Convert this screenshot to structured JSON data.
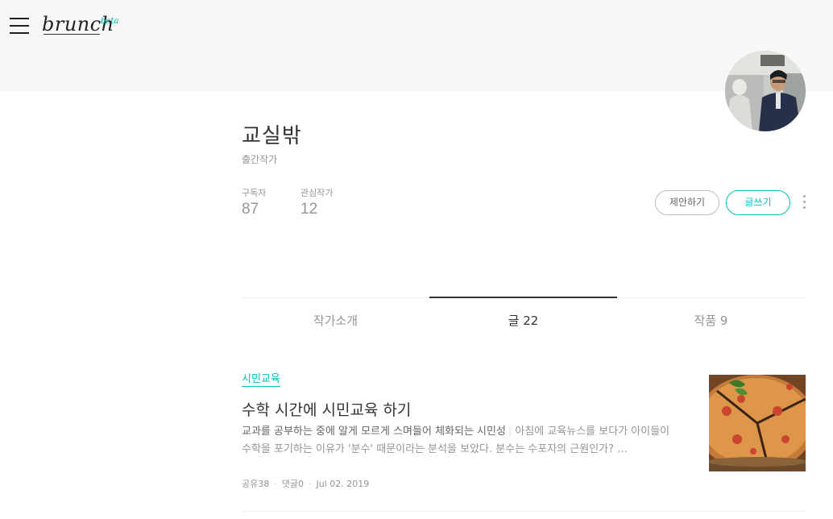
{
  "app": {
    "logo_text": "brunch",
    "logo_badge": "beta"
  },
  "profile": {
    "name": "교실밖",
    "role": "출간작가",
    "stats": [
      {
        "label": "구독자",
        "value": "87"
      },
      {
        "label": "관심작가",
        "value": "12"
      }
    ],
    "propose_label": "제안하기",
    "write_label": "글쓰기"
  },
  "tabs": [
    {
      "label": "작가소개",
      "active": false
    },
    {
      "label": "글 22",
      "active": true
    },
    {
      "label": "작품 9",
      "active": false
    }
  ],
  "articles": [
    {
      "tag": "시민교육",
      "title": "수학 시간에 시민교육 하기",
      "subtitle": "교과를 공부하는 중에 알게 모르게 스며들어 체화되는 시민성",
      "excerpt": "아침에 교육뉴스를 보다가 아이들이 수학을 포기하는 이유가 '분수' 때문이라는 분석을 보았다. 분수는 수포자의 근원인가? …",
      "shares": "공유38",
      "comments": "댓글0",
      "date": "Jul 02. 2019"
    }
  ],
  "colors": {
    "accent": "#00c3bd",
    "header_bg": "#f7f7f7",
    "muted_text": "#959595"
  },
  "icons": [
    "menu-icon",
    "more-icon"
  ]
}
